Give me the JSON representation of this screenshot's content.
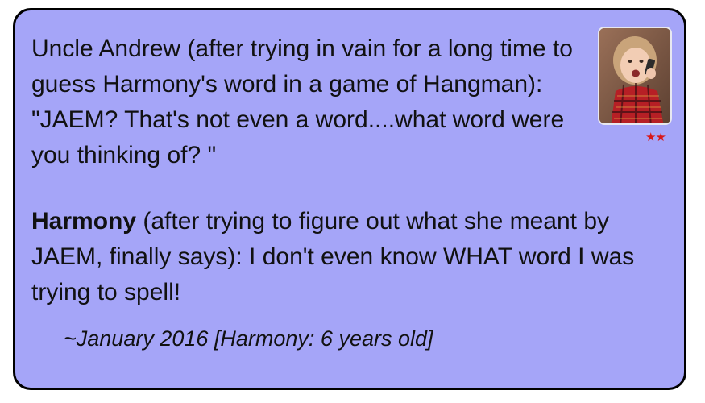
{
  "quote": {
    "para1_text": "Uncle Andrew (after trying in vain for a long time to guess Harmony's word in a game of Hangman): \"JAEM? That's not even a word....what word were you thinking of? \"",
    "para2_speaker": "Harmony",
    "para2_text": " (after trying to figure out what she meant by JAEM, finally says): I don't even know WHAT word I was trying to spell!",
    "date": "~January 2016 [Harmony: 6 years old]",
    "rating_stars": "★★",
    "rating": 2
  },
  "photo": {
    "icon": "child-portrait-photo"
  },
  "colors": {
    "card_background": "#a5a5f8",
    "card_border": "#000000",
    "star_color": "#d81818"
  }
}
